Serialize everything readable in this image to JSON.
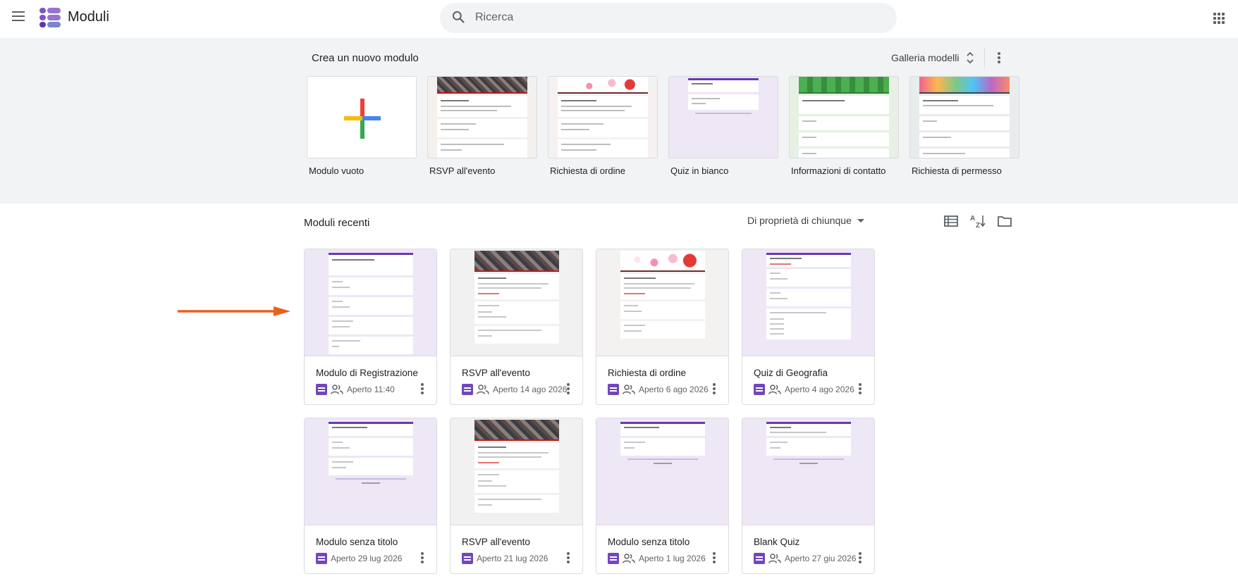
{
  "header": {
    "app_title": "Moduli",
    "search_placeholder": "Ricerca"
  },
  "gallery": {
    "title": "Crea un nuovo modulo",
    "gallery_button": "Galleria modelli",
    "templates": [
      {
        "label": "Modulo vuoto"
      },
      {
        "label": "RSVP all'evento"
      },
      {
        "label": "Richiesta di ordine"
      },
      {
        "label": "Quiz in bianco"
      },
      {
        "label": "Informazioni di contatto"
      },
      {
        "label": "Richiesta di permesso"
      }
    ]
  },
  "recent": {
    "title": "Moduli recenti",
    "owner_filter": "Di proprietà di chiunque",
    "cards": [
      {
        "title": "Modulo di Registrazione",
        "meta": "Aperto 11:40",
        "shared": true
      },
      {
        "title": "RSVP all'evento",
        "meta": "Aperto 14 ago 2026",
        "shared": true
      },
      {
        "title": "Richiesta di ordine",
        "meta": "Aperto 6 ago 2026",
        "shared": true
      },
      {
        "title": "Quiz di Geografia",
        "meta": "Aperto 4 ago 2026",
        "shared": true
      },
      {
        "title": "Modulo senza titolo",
        "meta": "Aperto 29 lug 2026",
        "shared": false
      },
      {
        "title": "RSVP all'evento",
        "meta": "Aperto 21 lug 2026",
        "shared": false
      },
      {
        "title": "Modulo senza titolo",
        "meta": "Aperto 1 lug 2026",
        "shared": true
      },
      {
        "title": "Blank Quiz",
        "meta": "Aperto 27 giu 2026",
        "shared": true
      }
    ]
  },
  "colors": {
    "accent": "#673ab7",
    "forms_icon": "#7248b9",
    "annotation_arrow": "#e8631a"
  },
  "icons": [
    "menu-icon",
    "forms-logo-icon",
    "search-icon",
    "apps-grid-icon",
    "sort-updown-icon",
    "more-vert-icon",
    "list-view-icon",
    "sort-az-icon",
    "folder-icon",
    "forms-icon",
    "shared-people-icon"
  ]
}
